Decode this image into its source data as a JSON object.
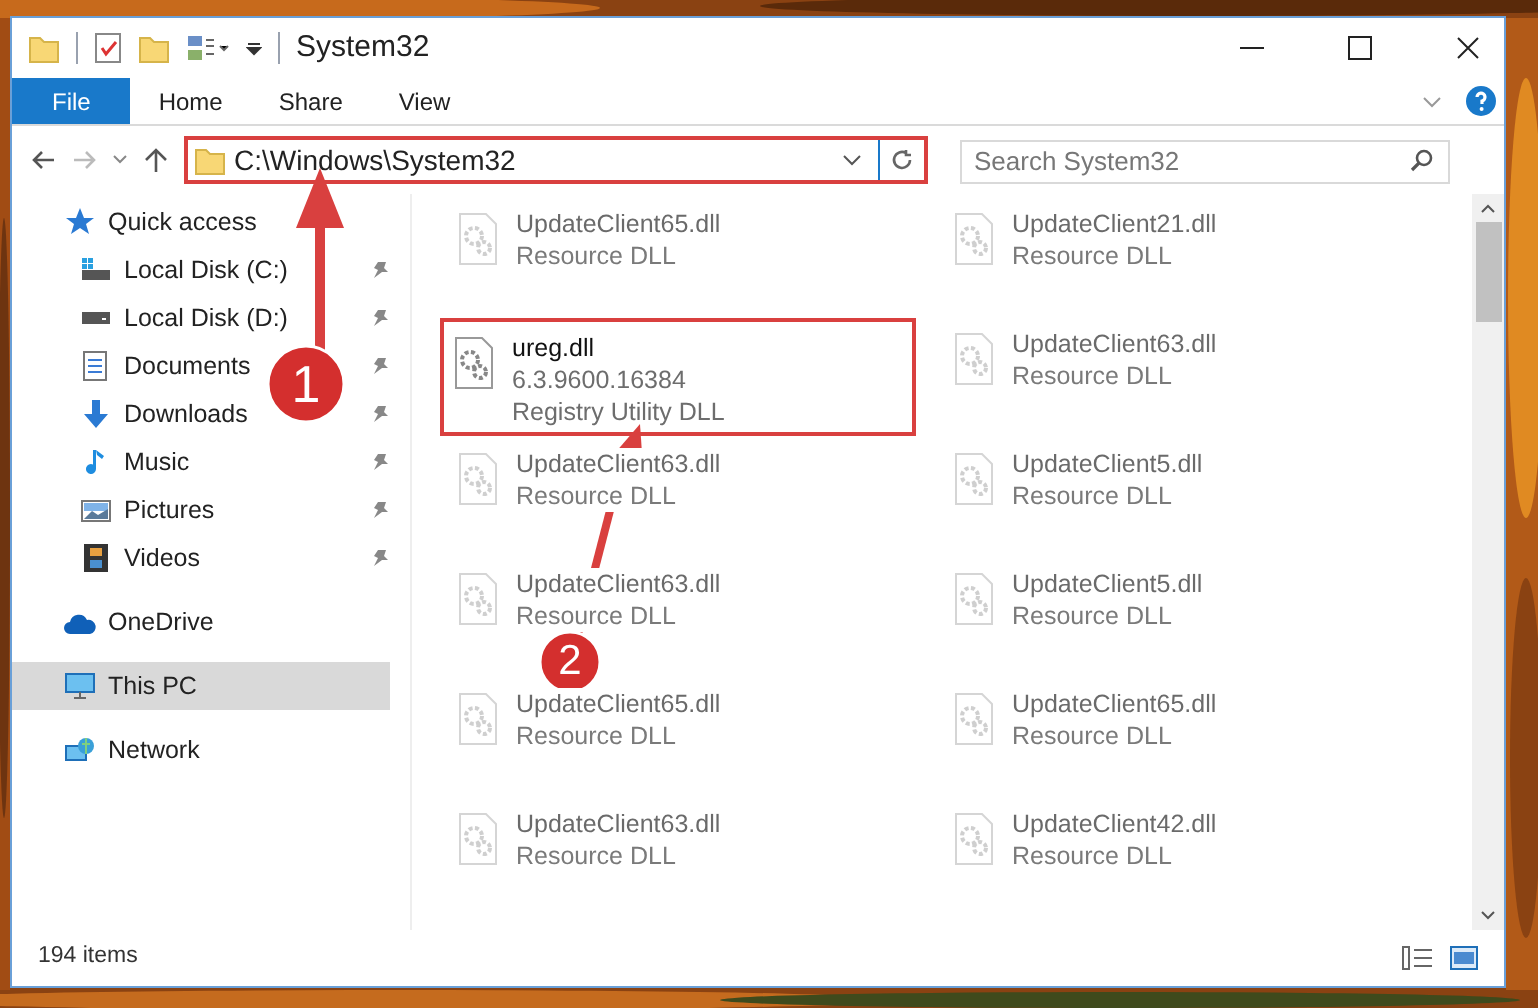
{
  "window": {
    "title": "System32"
  },
  "ribbon": {
    "tabs": [
      {
        "label": "File",
        "selected": true
      },
      {
        "label": "Home",
        "selected": false
      },
      {
        "label": "Share",
        "selected": false
      },
      {
        "label": "View",
        "selected": false
      }
    ]
  },
  "address": {
    "path": "C:\\Windows\\System32",
    "search_placeholder": "Search System32"
  },
  "sidebar": {
    "items": [
      {
        "label": "Quick access",
        "selected": false,
        "children": [
          {
            "label": "Local Disk (C:)",
            "pinned": true,
            "selected": false
          },
          {
            "label": "Local Disk (D:)",
            "pinned": true,
            "selected": false
          },
          {
            "label": "Documents",
            "pinned": true,
            "selected": false
          },
          {
            "label": "Downloads",
            "pinned": true,
            "selected": false
          },
          {
            "label": "Music",
            "pinned": true,
            "selected": false
          },
          {
            "label": "Pictures",
            "pinned": true,
            "selected": false
          },
          {
            "label": "Videos",
            "pinned": true,
            "selected": false
          }
        ]
      },
      {
        "label": "OneDrive",
        "selected": false
      },
      {
        "label": "This PC",
        "selected": true
      },
      {
        "label": "Network",
        "selected": false
      }
    ]
  },
  "files": [
    {
      "name": "UpdateClient65.dll",
      "lines": [
        "Resource DLL"
      ],
      "faded": true
    },
    {
      "name": "UpdateClient21.dll",
      "lines": [
        "Resource DLL"
      ],
      "faded": true
    },
    {
      "name": "ureg.dll",
      "lines": [
        "6.3.9600.16384",
        "Registry Utility DLL"
      ],
      "faded": false
    },
    {
      "name": "UpdateClient63.dll",
      "lines": [
        "Resource DLL"
      ],
      "faded": true
    },
    {
      "name": "UpdateClient63.dll",
      "lines": [
        "Resource DLL"
      ],
      "faded": true
    },
    {
      "name": "UpdateClient5.dll",
      "lines": [
        "Resource DLL"
      ],
      "faded": true
    },
    {
      "name": "UpdateClient63.dll",
      "lines": [
        "Resource DLL"
      ],
      "faded": true
    },
    {
      "name": "UpdateClient5.dll",
      "lines": [
        "Resource DLL"
      ],
      "faded": true
    },
    {
      "name": "UpdateClient65.dll",
      "lines": [
        "Resource DLL"
      ],
      "faded": true
    },
    {
      "name": "UpdateClient65.dll",
      "lines": [
        "Resource DLL"
      ],
      "faded": true
    },
    {
      "name": "UpdateClient63.dll",
      "lines": [
        "Resource DLL"
      ],
      "faded": true
    },
    {
      "name": "UpdateClient42.dll",
      "lines": [
        "Resource DLL"
      ],
      "faded": true
    }
  ],
  "status_bar": {
    "count": "194 items"
  },
  "annotations": [
    {
      "number": "1"
    },
    {
      "number": "2"
    }
  ]
}
